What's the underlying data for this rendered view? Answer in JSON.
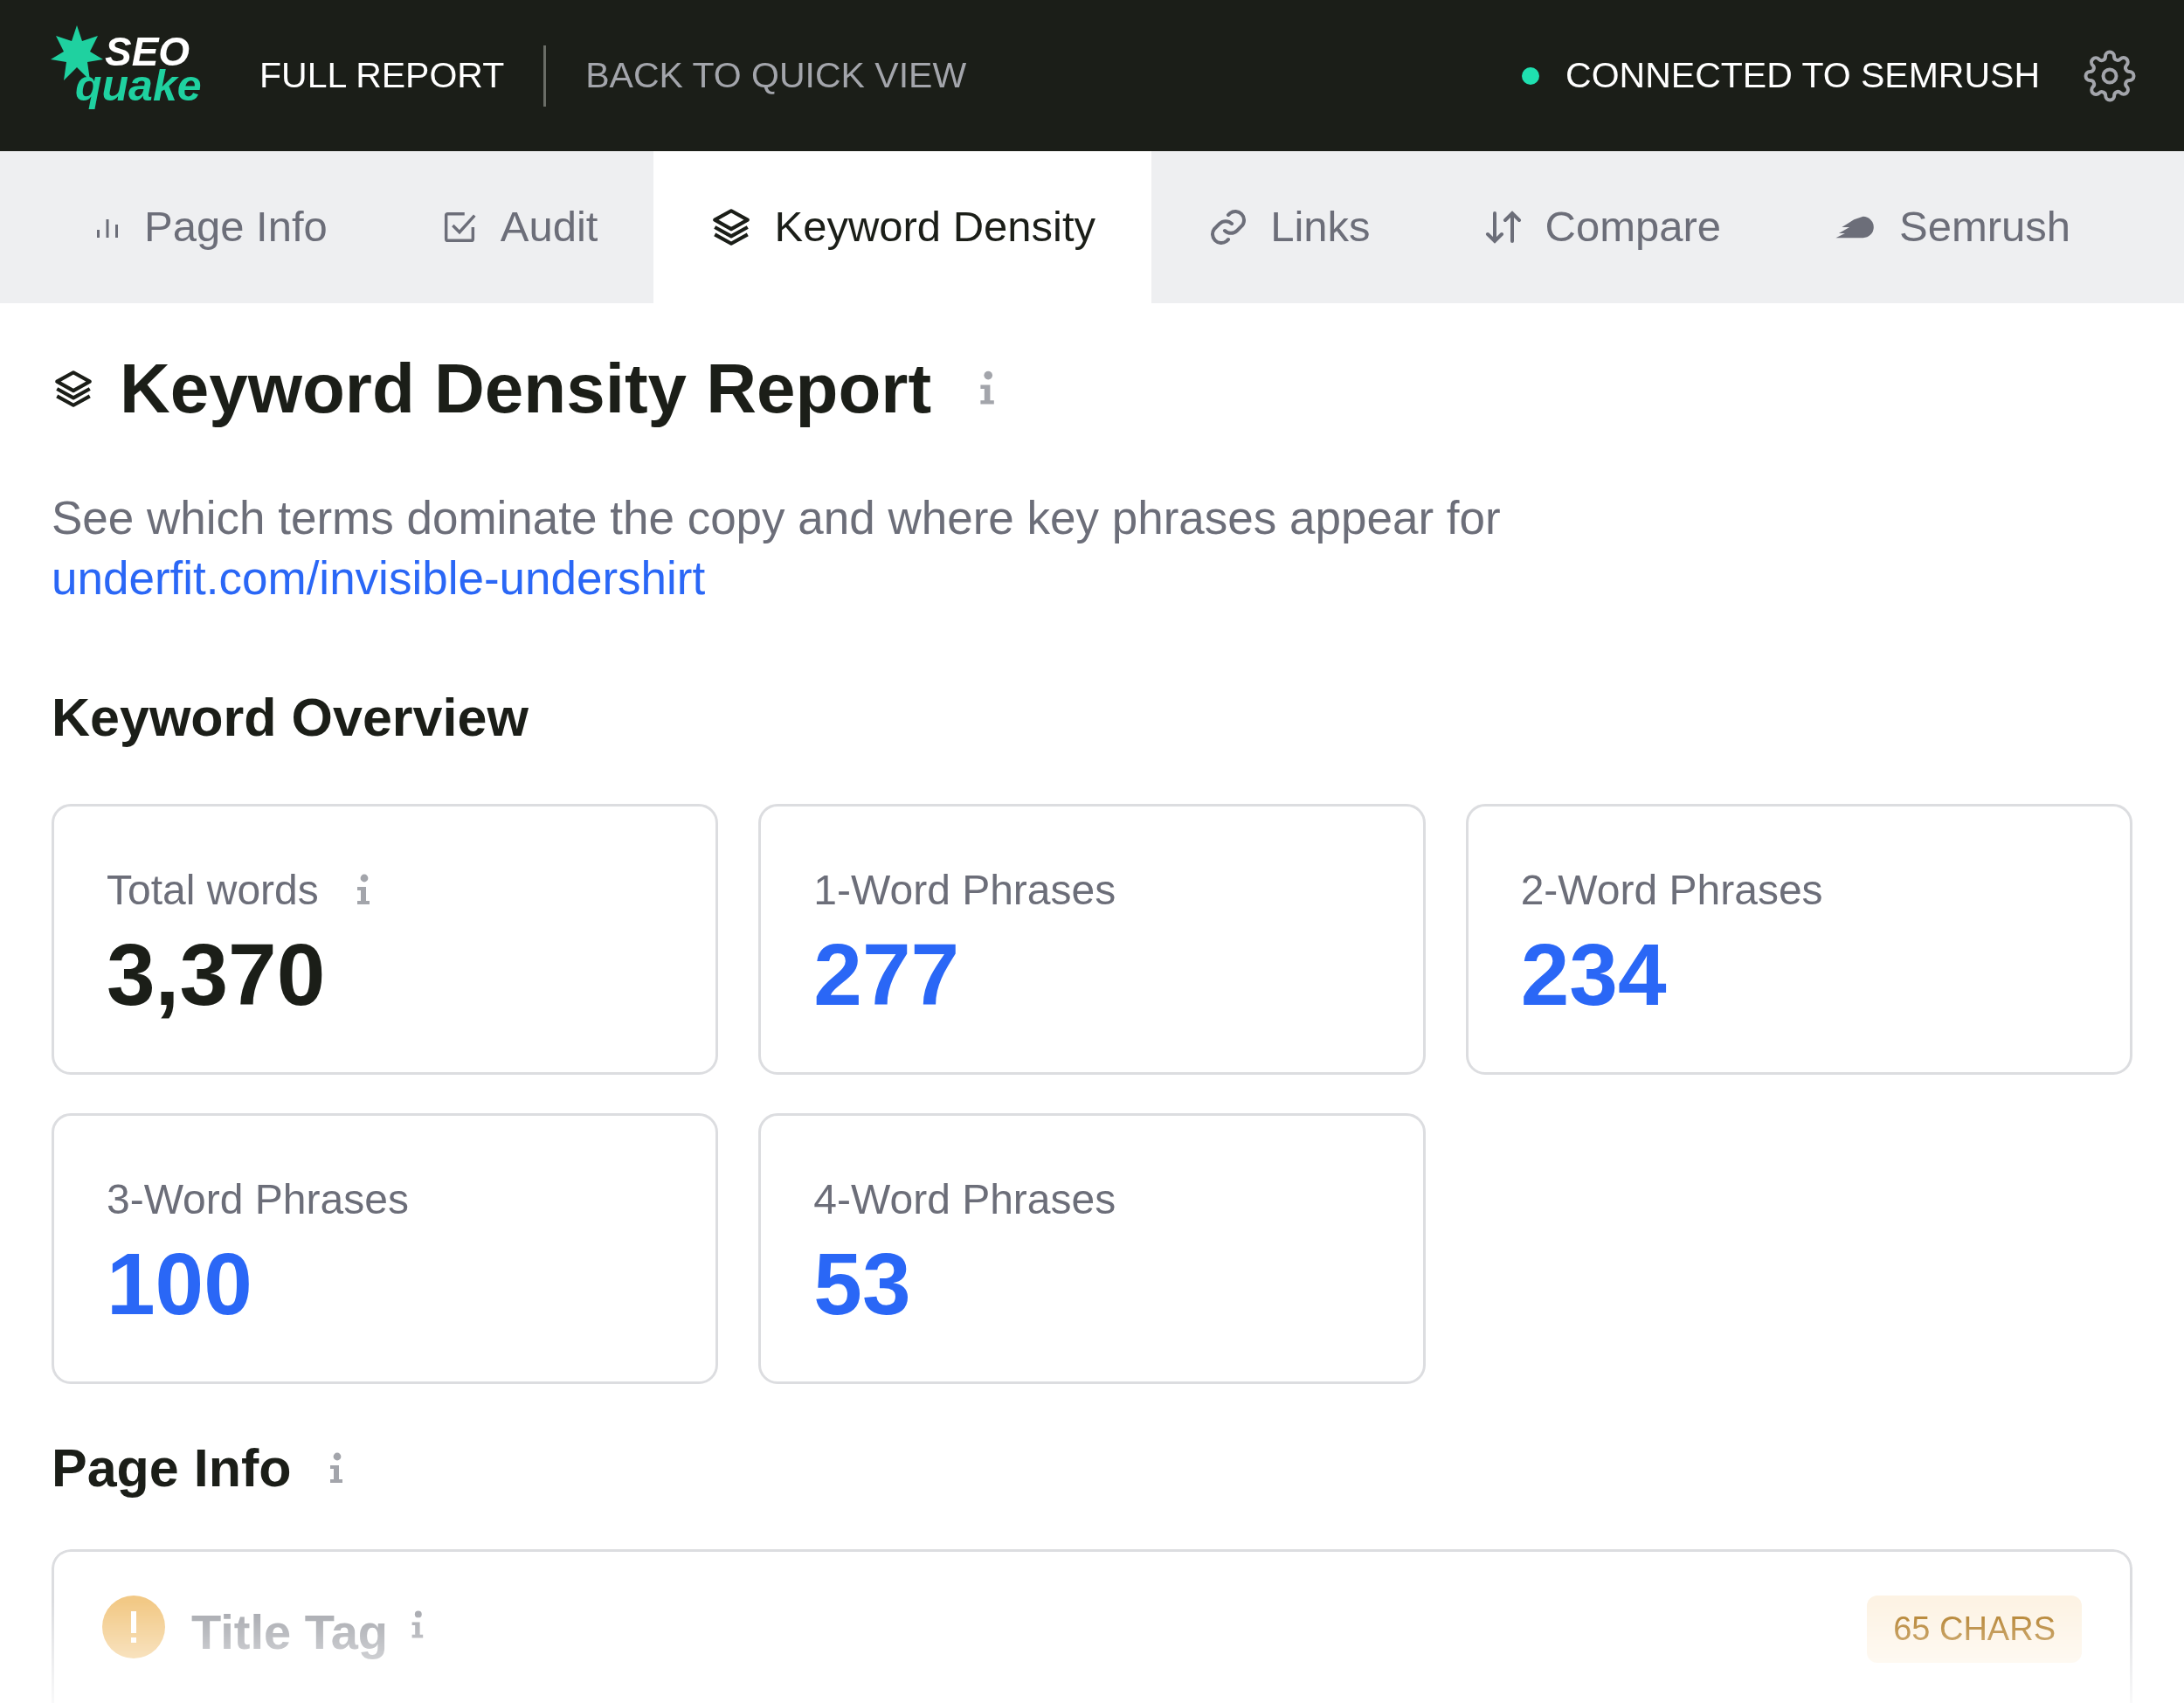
{
  "header": {
    "logo": {
      "top": "SEO",
      "bottom": "quake"
    },
    "nav": [
      {
        "label": "FULL REPORT",
        "selected": true
      },
      {
        "label": "BACK TO QUICK VIEW",
        "selected": false
      }
    ],
    "status": {
      "label": "CONNECTED TO SEMRUSH",
      "connected": true
    }
  },
  "tabs": [
    {
      "label": "Page Info",
      "selected": false
    },
    {
      "label": "Audit",
      "selected": false
    },
    {
      "label": "Keyword Density",
      "selected": true
    },
    {
      "label": "Links",
      "selected": false
    },
    {
      "label": "Compare",
      "selected": false
    },
    {
      "label": "Semrush",
      "selected": false
    }
  ],
  "report": {
    "title": "Keyword Density Report",
    "description": "See which terms dominate the copy and where key phrases appear for",
    "url": "underfit.com/invisible-undershirt"
  },
  "overview": {
    "heading": "Keyword Overview",
    "stats": [
      {
        "label": "Total words",
        "info": true,
        "value": "3,370",
        "kind": "total"
      },
      {
        "label": "1-Word Phrases",
        "info": false,
        "value": "277",
        "kind": "phrases"
      },
      {
        "label": "2-Word Phrases",
        "info": false,
        "value": "234",
        "kind": "phrases"
      },
      {
        "label": "3-Word Phrases",
        "info": false,
        "value": "100",
        "kind": "phrases"
      },
      {
        "label": "4-Word Phrases",
        "info": false,
        "value": "53",
        "kind": "phrases"
      }
    ]
  },
  "page_info": {
    "heading": "Page Info",
    "items": [
      {
        "label": "Title Tag",
        "badge": "65 CHARS"
      }
    ]
  }
}
